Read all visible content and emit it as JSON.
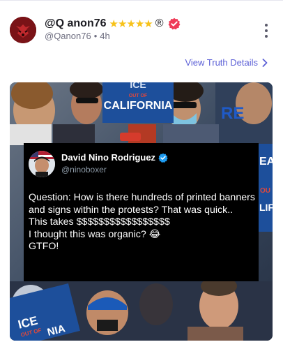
{
  "post": {
    "display_name": "@Q anon76",
    "stars": "★★★★★",
    "registered_mark": "®",
    "handle": "@Qanon76",
    "separator": "•",
    "time_ago": "4h",
    "details_link": "View Truth Details",
    "details_chevron": "›"
  },
  "embedded_tweet": {
    "author_name": "David Nino Rodriguez",
    "author_handle": "@ninoboxer",
    "lines": [
      "Question: How is there hundreds of printed banners and signs within the protests? That was quick..",
      "This takes $$$$$$$$$$$$$$$$$",
      "I thought this was organic? 😂",
      "GTFO!"
    ]
  },
  "photo_signs": {
    "top_sign_line1": "ICE",
    "top_sign_line2": "OUT OF",
    "top_sign_line3": "CALIFORNIA",
    "bottom_sign_line1": "ICE",
    "bottom_sign_line2": "OUT OF",
    "bottom_sign_line3": "NIA",
    "right_sign": "EA",
    "right_sign_small": "OU",
    "right_sign_tail": "LIF",
    "shirt_text": "RE"
  },
  "colors": {
    "name_text": "#1c1c22",
    "muted_text": "#6e6e80",
    "link": "#5b5fd6",
    "stars": "#f7c21a",
    "verified_badge": "#ef3a57",
    "tweet_bg": "#000000",
    "tweet_verified": "#1d9bf0"
  }
}
